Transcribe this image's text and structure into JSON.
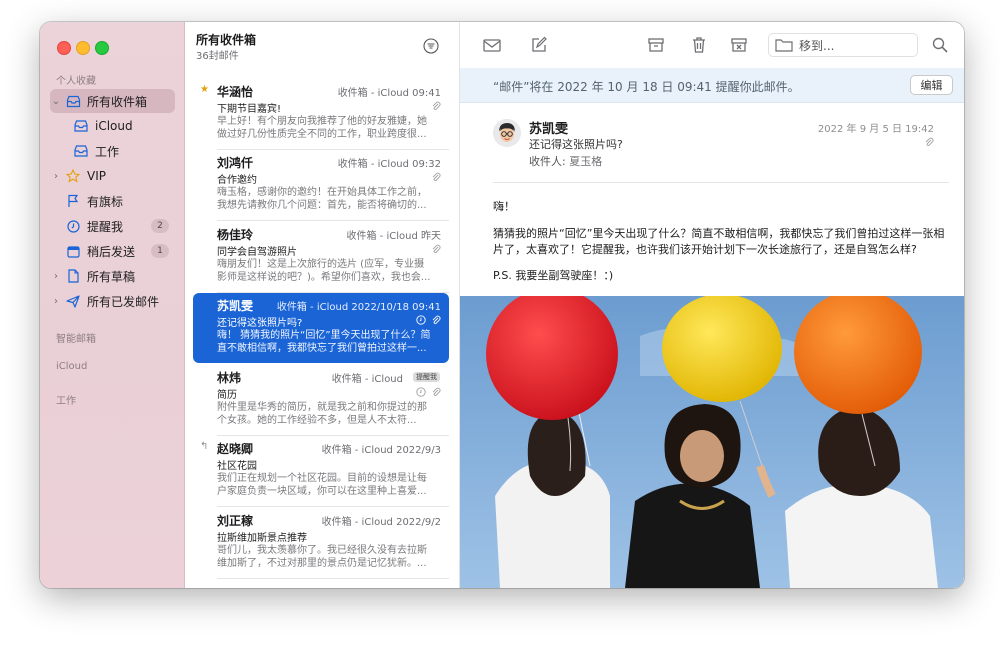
{
  "sidebar": {
    "favorites_heading": "个人收藏",
    "items": [
      {
        "label": "所有收件箱",
        "icon": "tray-stack-icon"
      },
      {
        "label": "iCloud",
        "icon": "inbox-icon"
      },
      {
        "label": "工作",
        "icon": "inbox-icon"
      },
      {
        "label": "VIP",
        "icon": "star-icon"
      },
      {
        "label": "有旗标",
        "icon": "flag-icon"
      },
      {
        "label": "提醒我",
        "icon": "clock-icon",
        "badge": "2"
      },
      {
        "label": "稍后发送",
        "icon": "calendar-icon",
        "badge": "1"
      },
      {
        "label": "所有草稿",
        "icon": "document-icon"
      },
      {
        "label": "所有已发邮件",
        "icon": "paperplane-icon"
      }
    ],
    "section_smart": "智能邮箱",
    "section_icloud": "iCloud",
    "section_work": "工作"
  },
  "list": {
    "title": "所有收件箱",
    "count": "36封邮件",
    "messages": [
      {
        "sender": "华涵怡",
        "meta": "收件箱 - iCloud  09:41",
        "subject": "下期节目嘉宾!",
        "preview": "早上好！有个朋友向我推荐了他的好友雅婕，她做过好几份性质完全不同的工作，职业跨度很..."
      },
      {
        "sender": "刘鸿仟",
        "meta": "收件箱 - iCloud  09:32",
        "subject": "合作邀约",
        "preview": "嗨玉格，感谢你的邀约！在开始具体工作之前，我想先请教你几个问题：首先，能否将确切的..."
      },
      {
        "sender": "杨佳玲",
        "meta": "收件箱 - iCloud  昨天",
        "subject": "同学会自驾游照片",
        "preview": "嗨朋友们！这是上次旅行的选片 (应军，专业摄影师是这样说的吧？)。希望你们喜欢，我也会..."
      },
      {
        "sender": "苏凯雯",
        "meta": "收件箱 - iCloud  2022/10/18 09:41",
        "subject": "还记得这张照片吗?",
        "preview": "嗨！ 猜猜我的照片“回忆”里今天出现了什么？简直不敢相信啊，我都快忘了我们曾拍过这样一..."
      },
      {
        "sender": "林炜",
        "meta": "收件箱 - iCloud",
        "tag": "提醒我",
        "subject": "简历",
        "preview": "附件里是华秀的简历，就是我之前和你提过的那个女孩。她的工作经验不多，但是人不太符..."
      },
      {
        "sender": "赵晓卿",
        "meta": "收件箱 - iCloud  2022/9/3",
        "subject": "社区花园",
        "preview": "我们正在规划一个社区花园。目前的设想是让每户家庭负责一块区域，你可以在这里种上喜爱..."
      },
      {
        "sender": "刘正稼",
        "meta": "收件箱 - iCloud  2022/9/2",
        "subject": "拉斯维加斯景点推荐",
        "preview": "哥们儿，我太羡慕你了。我已经很久没有去拉斯维加斯了，不过对那里的景点仍是记忆犹新。..."
      }
    ]
  },
  "toolbar": {
    "move_to": "移到..."
  },
  "banner": {
    "text": "“邮件”将在 2022 年 10 月 18 日 09:41 提醒你此邮件。",
    "edit": "编辑"
  },
  "message": {
    "from": "苏凯雯",
    "subject": "还记得这张照片吗?",
    "to_label": "收件人:",
    "to_name": "夏玉格",
    "date": "2022 年 9 月 5 日 19:42",
    "greeting": "嗨！",
    "body": "猜猜我的照片“回忆”里今天出现了什么？简直不敢相信啊，我都快忘了我们曾拍过这样一张相片了，太喜欢了！它提醒我，也许我们该开始计划下一次长途旅行了，还是自驾怎么样?",
    "ps": "P.S. 我要坐副驾驶座！：)"
  },
  "colors": {
    "accent": "#1a64d6",
    "sidebar_bg": "#ebd3d9",
    "banner_bg": "#e9f2fb"
  }
}
